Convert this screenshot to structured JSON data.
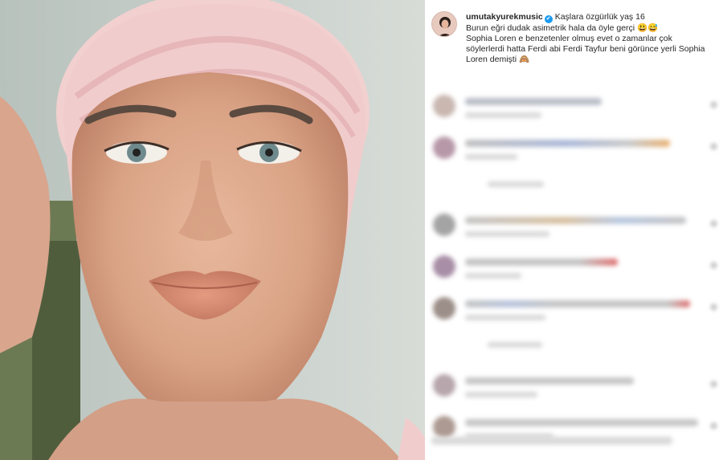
{
  "post": {
    "username": "umutakyurekmusic",
    "verified_badge": "✔",
    "caption_lines": [
      "Kaşlara özgürlük yaş 16",
      "Burun eğri dudak asimetrik hala da öyle gerçi 😃😅",
      "Sophia Loren e benzetenler olmuş evet o zamanlar çok",
      "söylerlerdi hatta Ferdi abi Ferdi Tayfur beni görünce yerli Sophia",
      "Loren demişti 🙈"
    ]
  },
  "icons": {
    "verified": "verified-badge-icon",
    "heart": "heart-icon"
  },
  "colors": {
    "verified": "#1d9bf0",
    "text": "#262626",
    "panel_bg": "#ffffff"
  }
}
